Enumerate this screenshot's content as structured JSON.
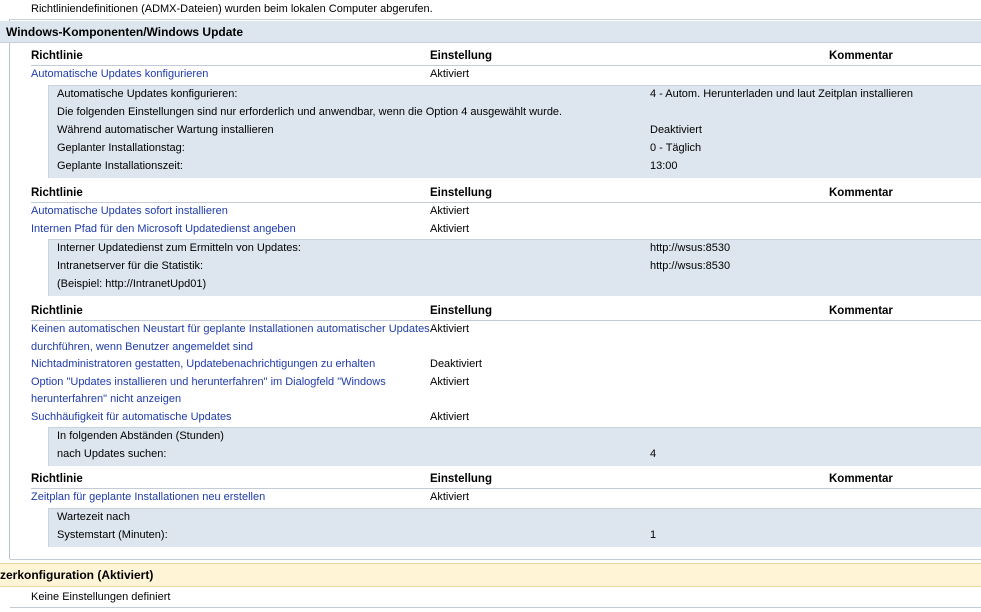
{
  "top_note": "Richtliniendefinitionen (ADMX-Dateien) wurden beim lokalen Computer abgerufen.",
  "section_title": "Windows-Komponenten/Windows Update",
  "columns": {
    "policy": "Richtlinie",
    "setting": "Einstellung",
    "comment": "Kommentar"
  },
  "groups": [
    {
      "policies": [
        {
          "name_lines": [
            "Automatische Updates konfigurieren"
          ],
          "value": "Aktiviert"
        }
      ],
      "details": [
        {
          "label": "Automatische Updates konfigurieren:",
          "value": "4 - Autom. Herunterladen und laut Zeitplan installieren"
        },
        {
          "label": "Die folgenden Einstellungen sind nur erforderlich und anwendbar, wenn die Option 4 ausgewählt wurde.",
          "value": ""
        },
        {
          "label": "Während automatischer Wartung installieren",
          "value": "Deaktiviert"
        },
        {
          "label": "Geplanter Installationstag:",
          "value": "0 - Täglich"
        },
        {
          "label": "Geplante Installationszeit:",
          "value": "13:00"
        }
      ]
    },
    {
      "policies": [
        {
          "name_lines": [
            "Automatische Updates sofort installieren"
          ],
          "value": "Aktiviert"
        },
        {
          "name_lines": [
            "Internen Pfad für den Microsoft Updatedienst angeben"
          ],
          "value": "Aktiviert"
        }
      ],
      "details": [
        {
          "label": "Interner Updatedienst zum Ermitteln von Updates:",
          "value": "http://wsus:8530"
        },
        {
          "label": "Intranetserver für die Statistik:",
          "value": "http://wsus:8530"
        },
        {
          "label": "(Beispiel: http://IntranetUpd01)",
          "value": ""
        }
      ]
    },
    {
      "policies": [
        {
          "name_lines": [
            "Keinen automatischen Neustart für geplante Installationen automatischer Updates",
            "durchführen, wenn Benutzer angemeldet sind"
          ],
          "value": "Aktiviert"
        },
        {
          "name_lines": [
            "Nichtadministratoren gestatten, Updatebenachrichtigungen zu erhalten"
          ],
          "value": "Deaktiviert"
        },
        {
          "name_lines": [
            "Option \"Updates installieren und herunterfahren\" im Dialogfeld \"Windows",
            "herunterfahren\" nicht anzeigen"
          ],
          "value": "Aktiviert"
        },
        {
          "name_lines": [
            "Suchhäufigkeit für automatische Updates"
          ],
          "value": "Aktiviert"
        }
      ],
      "details": [
        {
          "label": "In folgenden Abständen (Stunden)",
          "value": ""
        },
        {
          "label": "nach Updates suchen:",
          "value": "4"
        }
      ]
    },
    {
      "policies": [
        {
          "name_lines": [
            "Zeitplan für geplante Installationen neu erstellen"
          ],
          "value": "Aktiviert"
        }
      ],
      "details": [
        {
          "label": "Wartezeit nach",
          "value": ""
        },
        {
          "label": "Systemstart (Minuten):",
          "value": "1"
        }
      ]
    }
  ],
  "user_section_title": "zerkonfiguration (Aktiviert)",
  "user_section_note": "Keine Einstellungen definiert",
  "colors": {
    "link": "#1f3ba8",
    "section_bg": "#dde6ee",
    "user_section_bg": "#fff5d6"
  }
}
